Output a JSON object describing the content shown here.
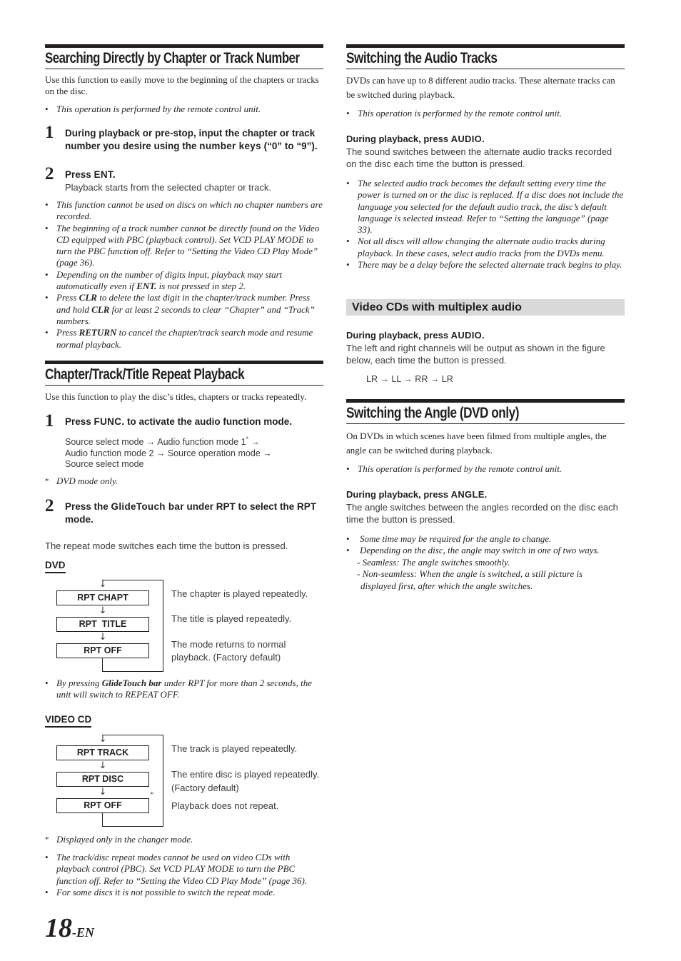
{
  "page": {
    "number": "18",
    "suffix": "-EN"
  },
  "left": {
    "search": {
      "heading": "Searching Directly by Chapter or Track Number",
      "intro": "Use this function to easily move to the beginning of the chapters or tracks on the disc.",
      "remote_note": "This operation is performed by the remote control unit.",
      "steps": [
        {
          "num": "1",
          "title_pre": "During playback or pre-stop, input the chapter or track number you desire using the ",
          "title_key": "number keys",
          "title_post": " (“0” to “9”).",
          "desc": ""
        },
        {
          "num": "2",
          "title_pre": "Press ",
          "title_key": "ENT.",
          "title_post": "",
          "desc": "Playback starts from the selected chapter or track."
        }
      ],
      "notes": [
        {
          "pre": "This function cannot be used on discs on which no chapter numbers are recorded.",
          "bold": "",
          "post": "",
          "bold2": "",
          "post2": ""
        },
        {
          "pre": "The beginning of a track number cannot be directly found on the Video CD equipped with PBC (playback control). Set VCD PLAY MODE to turn the PBC function off. Refer to “Setting the Video CD Play Mode” (page 36).",
          "bold": "",
          "post": "",
          "bold2": "",
          "post2": ""
        },
        {
          "pre": "Depending on the number of digits input, playback may start automatically even if ",
          "bold": "ENT.",
          "post": " is not pressed in step 2.",
          "bold2": "",
          "post2": ""
        },
        {
          "pre": "Press ",
          "bold": "CLR",
          "post": " to delete the last digit in the chapter/track number. Press and hold ",
          "bold2": "CLR",
          "post2": " for at least 2 seconds to clear “Chapter” and “Track” numbers."
        },
        {
          "pre": "Press ",
          "bold": "RETURN",
          "post": " to cancel the chapter/track search mode and resume normal playback.",
          "bold2": "",
          "post2": ""
        }
      ]
    },
    "repeat": {
      "heading": "Chapter/Track/Title Repeat Playback",
      "intro": "Use this function to play the disc’s titles, chapters or tracks repeatedly.",
      "step1": {
        "num": "1",
        "title_pre": "Press ",
        "title_key": "FUNC.",
        "title_post": " to activate the audio function mode."
      },
      "mode_flow": {
        "line1_a": "Source select mode → Audio function mode 1",
        "line1_star": "*",
        "line1_b": " →",
        "line2": "Audio function mode 2 → Source operation mode →",
        "line3": "Source select mode"
      },
      "dvd_only_note": {
        "star": "*",
        "text": "DVD mode only."
      },
      "step2": {
        "num": "2",
        "title_pre": "Press the ",
        "title_key": "GlideTouch bar",
        "title_post": " under RPT to select the RPT mode."
      },
      "switch_text": "The repeat mode switches each time the button is pressed.",
      "dvd": {
        "label": "DVD",
        "modes": [
          {
            "box": "RPT CHAPT",
            "desc": "The chapter is played repeatedly."
          },
          {
            "box": "RPT  TITLE",
            "desc": "The title is played repeatedly."
          },
          {
            "box": "RPT OFF",
            "desc_line1": "The mode returns to normal",
            "desc_line2": "playback. (Factory default)"
          }
        ],
        "arrow": "↓",
        "note_pre": "By pressing ",
        "note_bold": "GlideTouch bar",
        "note_post": " under RPT for more than 2 seconds, the unit will switch to REPEAT OFF."
      },
      "vcd": {
        "label": "VIDEO CD",
        "modes": [
          {
            "box": "RPT TRACK",
            "desc": "The track is played repeatedly."
          },
          {
            "box": "RPT DISC",
            "desc_line1": "The entire disc is played repeatedly.",
            "desc_line2": "(Factory default)"
          },
          {
            "box": "RPT OFF",
            "desc": "Playback does not repeat."
          }
        ],
        "arrow": "↓",
        "star": "*",
        "changer_note": {
          "star": "*",
          "text": "Displayed only in the changer mode."
        }
      },
      "notes": [
        "The track/disc repeat modes cannot be used on video CDs with playback control (PBC). Set VCD PLAY MODE to turn the PBC function off. Refer to “Setting the Video CD Play Mode” (page 36).",
        "For some discs it is not possible to switch the repeat mode."
      ]
    }
  },
  "right": {
    "audio": {
      "heading": "Switching the Audio Tracks",
      "intro": "DVDs can have up to 8 different audio tracks. These alternate tracks can be switched during playback.",
      "remote_note": "This operation is performed by the remote control unit.",
      "instruction_pre": "During playback, press ",
      "instruction_key": "AUDIO",
      "instruction_post": ".",
      "desc": "The sound switches between the alternate audio tracks recorded on the disc each time the button is pressed.",
      "notes": [
        "The selected audio track becomes the default setting every time the power is turned on or the disc is replaced. If a disc does not include the language you selected for the default audio track, the disc’s default language is selected instead. Refer to “Setting the language” (page 33).",
        "Not all discs will allow changing the alternate audio tracks during playback. In these cases, select audio tracks from the DVDs menu.",
        "There may be a delay before the selected alternate track begins to play."
      ]
    },
    "multiplex": {
      "heading": "Video CDs with multiplex audio",
      "instruction_pre": "During playback, press ",
      "instruction_key": "AUDIO",
      "instruction_post": ".",
      "desc": "The left and right channels will be output as shown in the figure below, each time the button is pressed.",
      "sequence": "LR → LL → RR → LR"
    },
    "angle": {
      "heading": "Switching the Angle (DVD only)",
      "intro": "On DVDs in which scenes have been filmed from multiple angles, the angle can be switched during playback.",
      "remote_note": "This operation is performed by the remote control unit.",
      "instruction_pre": "During playback, press ",
      "instruction_key": "ANGLE",
      "instruction_post": ".",
      "desc": "The angle switches between the angles recorded on the disc each time the button is pressed.",
      "notes": [
        "Some time may be required for the angle to change.",
        "Depending on the disc, the angle may switch in one of two ways."
      ],
      "sub_notes": [
        "- Seamless: The angle switches smoothly.",
        "- Non-seamless: When the angle is switched, a still picture is",
        "displayed first, after which the angle switches."
      ]
    }
  }
}
